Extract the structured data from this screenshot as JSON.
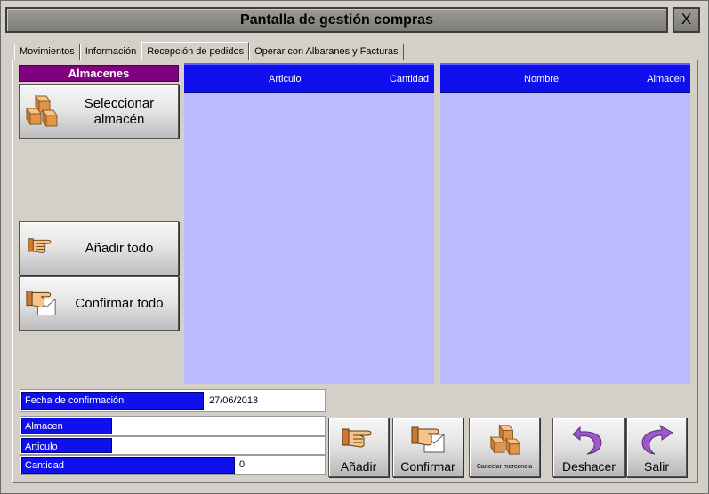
{
  "window": {
    "title": "Pantalla de gestión compras",
    "close_label": "X"
  },
  "tabs": [
    {
      "label": "Movimientos"
    },
    {
      "label": "Información"
    },
    {
      "label": "Recepción de pedidos"
    },
    {
      "label": "Operar con Albaranes y Facturas"
    }
  ],
  "active_tab": "Recepción de pedidos",
  "left_panel": {
    "header": "Almacenes",
    "select_button": "Seleccionar almacén",
    "add_all_button": "Añadir todo",
    "confirm_all_button": "Confirmar todo"
  },
  "articles_list": {
    "col_articulo": "Articulo",
    "col_cantidad": "Cantidad",
    "rows": []
  },
  "names_list": {
    "col_nombre": "Nombre",
    "col_almacen": "Almacen",
    "rows": []
  },
  "form": {
    "fecha_label": "Fecha de confirmación",
    "fecha_value": "27/06/2013",
    "almacen_label": "Almacen",
    "almacen_value": "",
    "articulo_label": "Articulo",
    "articulo_value": "",
    "cantidad_label": "Cantidad",
    "cantidad_value": "0"
  },
  "bottom_buttons": {
    "anadir": "Añadir",
    "confirmar": "Confirmar",
    "cancelar": "Cancelar mercancia",
    "deshacer": "Deshacer",
    "salir": "Salir"
  },
  "colors": {
    "header_purple": "#800080",
    "list_header_blue": "#1010ee",
    "list_body": "#bbbbff",
    "window_bg": "#d4d0c8"
  }
}
